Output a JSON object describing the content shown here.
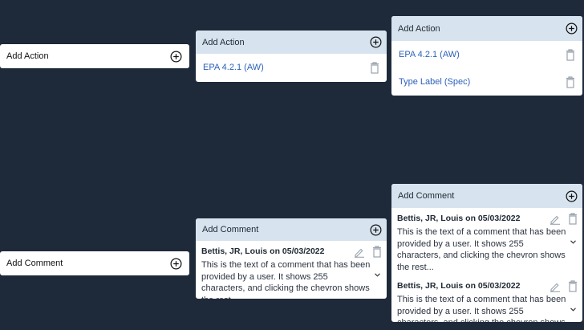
{
  "add_action": {
    "simple_label": "Add Action",
    "expanded_one": {
      "header": "Add Action",
      "items": [
        "EPA 4.2.1 (AW)"
      ]
    },
    "expanded_two": {
      "header": "Add Action",
      "items": [
        "EPA 4.2.1 (AW)",
        "Type Label (Spec)"
      ]
    }
  },
  "add_comment": {
    "simple_label": "Add Comment",
    "expanded_one": {
      "header": "Add Comment",
      "comments": [
        {
          "author": "Bettis, JR, Louis on 05/03/2022",
          "text": "This is the text of a comment that has been provided by a user. It shows 255 characters, and clicking the chevron shows the rest..."
        }
      ]
    },
    "expanded_two": {
      "header": "Add Comment",
      "comments": [
        {
          "author": "Bettis, JR, Louis on 05/03/2022",
          "text": "This is the text of a comment that has been provided by a user. It shows 255 characters, and clicking the chevron shows the rest..."
        },
        {
          "author": "Bettis, JR, Louis on 05/03/2022",
          "text": "This is the text of a comment that has been provided by a user. It shows 255 characters, and clicking the chevron shows the rest..."
        }
      ]
    }
  },
  "colors": {
    "background": "#1e2a3a",
    "header": "#d7e3ee",
    "link": "#2c62b8",
    "icon": "#9aa3ad"
  }
}
